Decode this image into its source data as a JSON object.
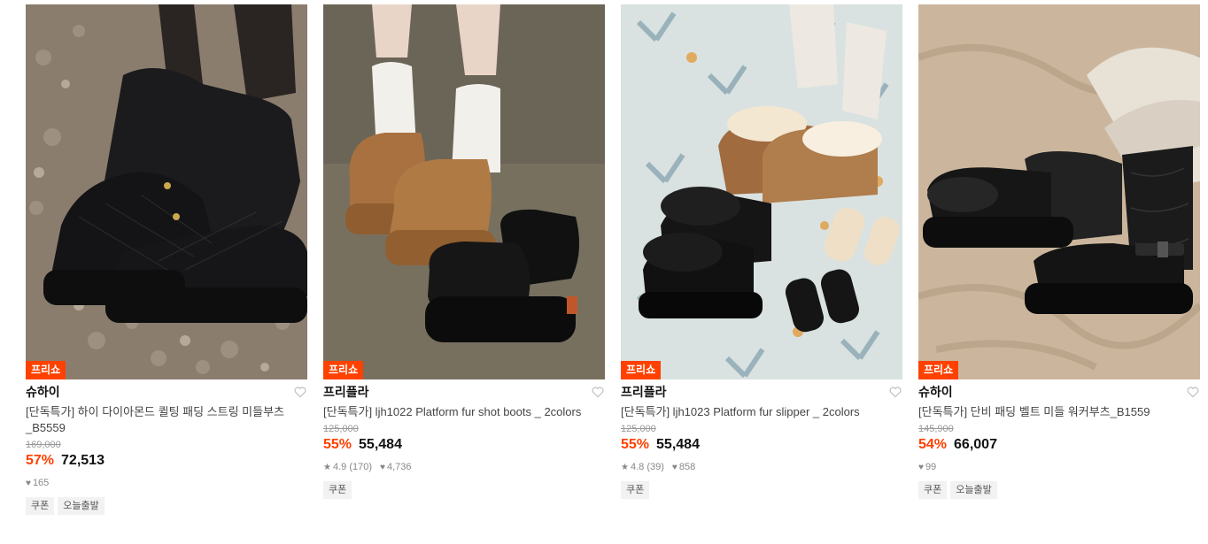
{
  "products": [
    {
      "badge": "프리쇼",
      "brand": "슈하이",
      "title": "[단독특가] 하이 다이아몬드 퀼팅 패딩 스트링 미들부츠_B5559",
      "original_price": "169,000",
      "discount": "57%",
      "price": "72,513",
      "rating": "",
      "reviews": "",
      "likes": "165",
      "tags": [
        "쿠폰",
        "오늘출발"
      ],
      "image": "black quilted padded string middle boots on gravel",
      "icon": "heart-icon"
    },
    {
      "badge": "프리쇼",
      "brand": "프리플라",
      "title": "[단독특가] ljh1022 Platform fur shot boots _ 2colors",
      "original_price": "125,000",
      "discount": "55%",
      "price": "55,484",
      "rating": "4.9",
      "reviews": "(170)",
      "likes": "4,736",
      "tags": [
        "쿠폰"
      ],
      "image": "camel and black platform fur short boots with white socks",
      "icon": "heart-icon"
    },
    {
      "badge": "프리쇼",
      "brand": "프리플라",
      "title": "[단독특가] ljh1023 Platform fur slipper _ 2colors",
      "original_price": "125,000",
      "discount": "55%",
      "price": "55,484",
      "rating": "4.8",
      "reviews": "(39)",
      "likes": "858",
      "tags": [
        "쿠폰"
      ],
      "image": "fur platform slippers on patterned tile floor",
      "icon": "heart-icon"
    },
    {
      "badge": "프리쇼",
      "brand": "슈하이",
      "title": "[단독특가] 단비 패딩 벨트 미들 워커부츠_B1559",
      "original_price": "145,900",
      "discount": "54%",
      "price": "66,007",
      "rating": "",
      "reviews": "",
      "likes": "99",
      "tags": [
        "쿠폰",
        "오늘출발"
      ],
      "image": "black padded belt middle walker boots on beige fabric",
      "icon": "heart-icon"
    }
  ],
  "colors": {
    "accent": "#ff4100",
    "text": "#111111",
    "muted": "#999999"
  }
}
